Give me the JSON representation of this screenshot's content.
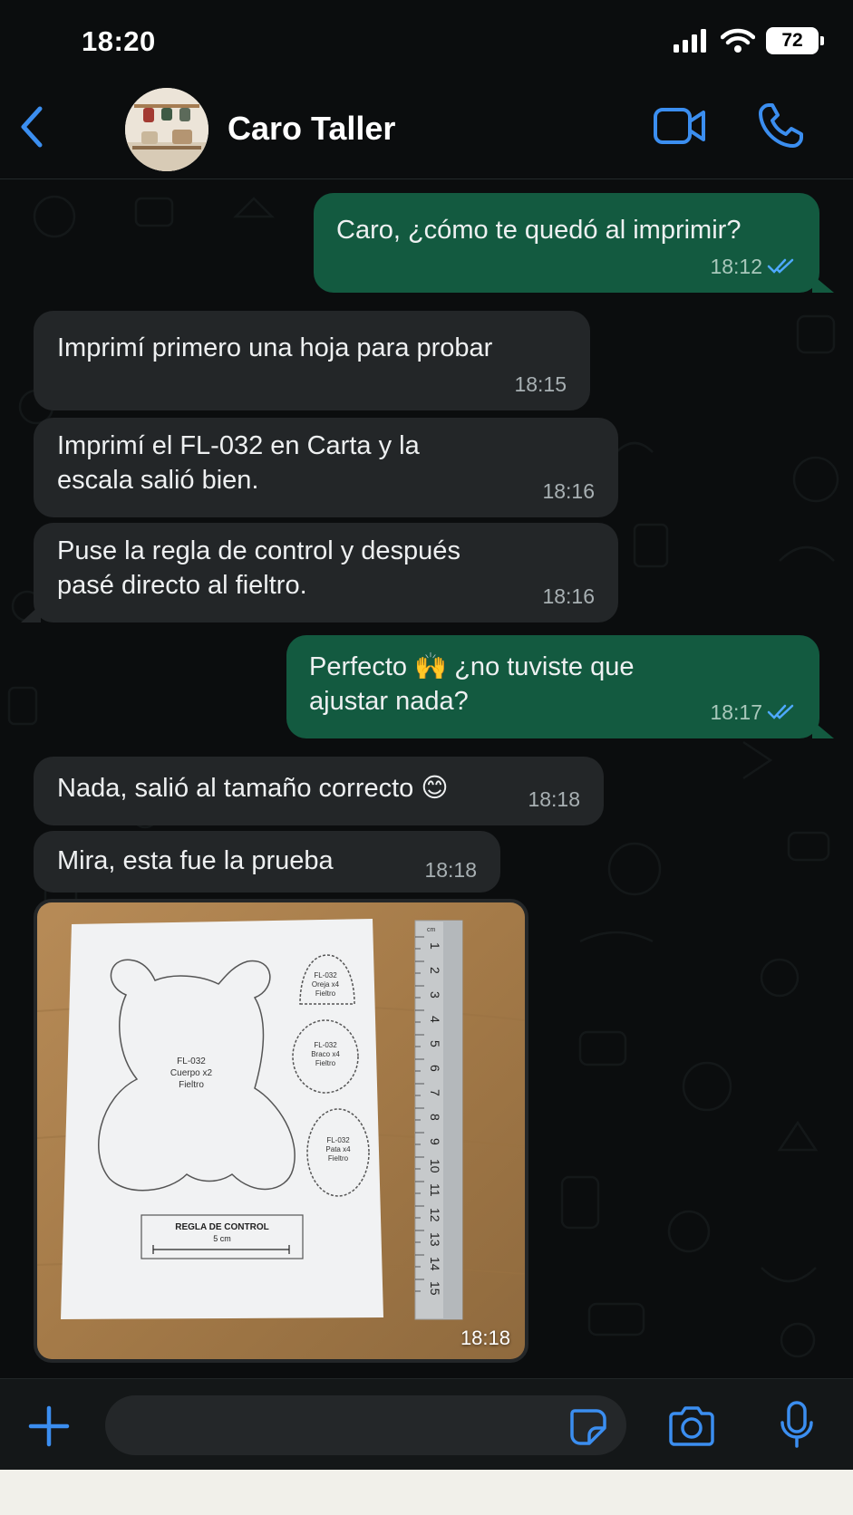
{
  "status_bar": {
    "time": "18:20",
    "battery": "72"
  },
  "header": {
    "contact_name": "Caro Taller"
  },
  "messages": [
    {
      "text": "Caro, ¿cómo te quedó al imprimir?",
      "time": "18:12"
    },
    {
      "text": "Imprimí primero una hoja para probar",
      "time": "18:15"
    },
    {
      "line1": "Imprimí el FL-032 en Carta y la",
      "line2": "escala salió bien.",
      "time": "18:16"
    },
    {
      "line1": "Puse la regla de control y después",
      "line2": "pasé directo al fieltro.",
      "time": "18:16"
    },
    {
      "line1": "Perfecto 🙌 ¿no tuviste que",
      "line2": "ajustar nada?",
      "time": "18:17"
    },
    {
      "text": "Nada, salió al tamaño correcto 😊",
      "time": "18:18"
    },
    {
      "text": "Mira, esta fue la prueba",
      "time": "18:18"
    }
  ],
  "photo": {
    "time": "18:18",
    "body_label": [
      "FL-032",
      "Cuerpo x2",
      "Fieltro"
    ],
    "ear_label": [
      "FL-032",
      "Oreja x4",
      "Fieltro"
    ],
    "arm_label": [
      "FL-032",
      "Braco x4",
      "Fieltro"
    ],
    "leg_label": [
      "FL-032",
      "Pata x4",
      "Fieltro"
    ],
    "control_title": "REGLA DE CONTROL",
    "control_size": "5 cm",
    "ruler_unit": "cm",
    "ruler_numbers": [
      "1",
      "2",
      "3",
      "4",
      "5",
      "6",
      "7",
      "8",
      "9",
      "10",
      "11",
      "12",
      "13",
      "14",
      "15"
    ]
  },
  "colors": {
    "accent": "#3b8ef0",
    "outgoing": "#135a40",
    "incoming": "#232628",
    "background": "#0b0d0e"
  },
  "icons": {
    "back": "chevron-left-icon",
    "video": "video-camera-icon",
    "call": "phone-icon",
    "plus": "plus-icon",
    "sticker": "sticker-icon",
    "camera": "camera-icon",
    "mic": "microphone-icon",
    "read": "double-check-icon"
  }
}
